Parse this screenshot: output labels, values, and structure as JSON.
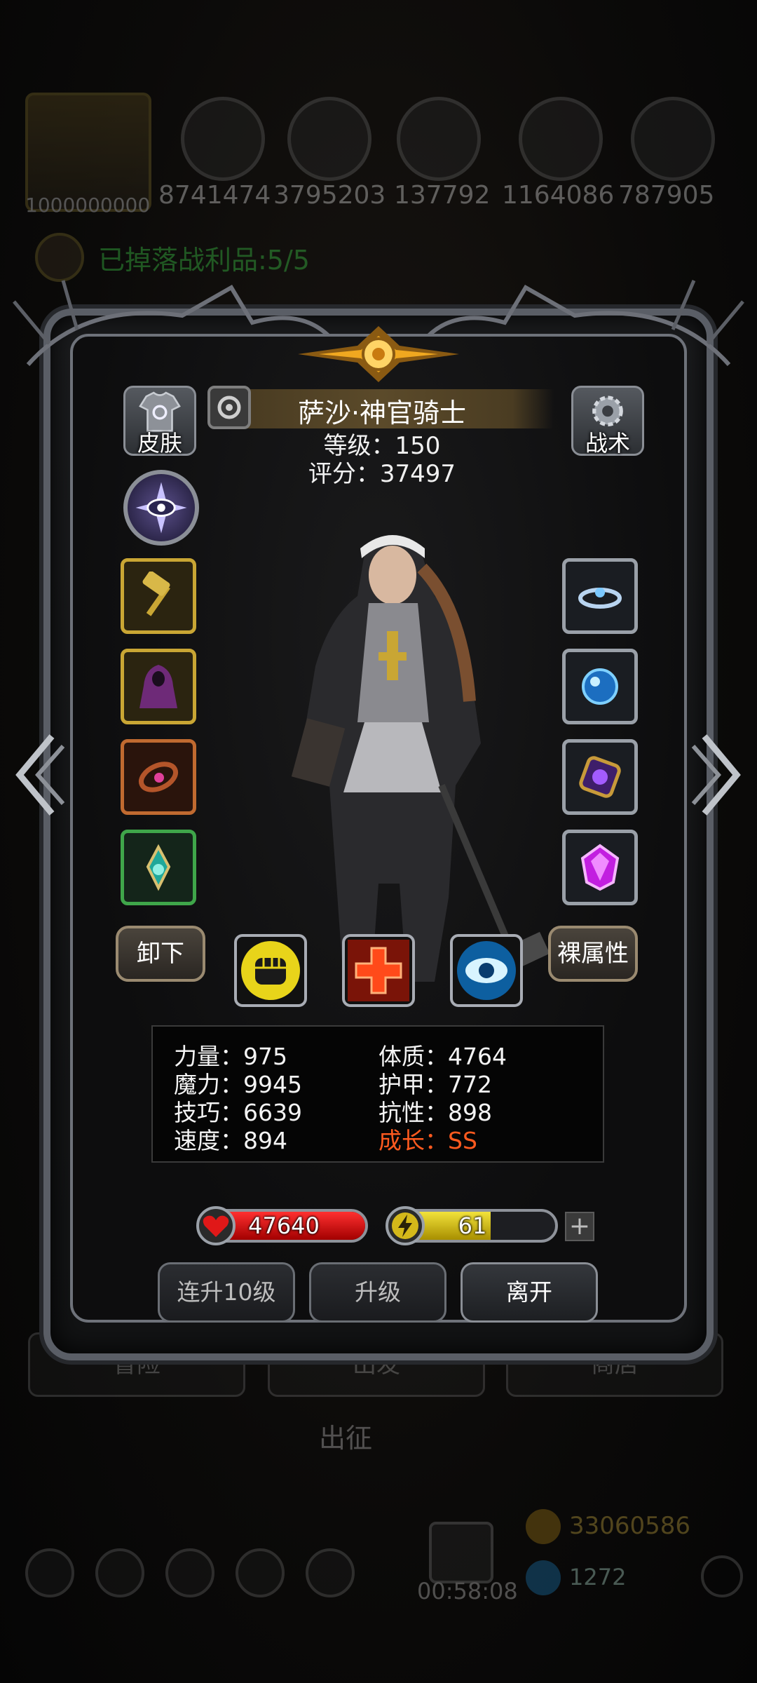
{
  "background": {
    "portrait_number": "1000000000",
    "resources": [
      "8741474",
      "3795203",
      "137792",
      "1164086",
      "787905"
    ],
    "loot_text": "已掉落战利品:5/5",
    "bottom_buttons": [
      "冒险",
      "出发",
      "商店"
    ],
    "center_label": "出征",
    "timer": "00:58:08",
    "gold": "33060586",
    "gems": "1272"
  },
  "panel": {
    "skin_label": "皮肤",
    "tactic_label": "战术",
    "hero_name": "萨沙·神官骑士",
    "level": "等级：150",
    "score": "评分：37497"
  },
  "equipment": {
    "left": [
      "hammer-icon",
      "hooded-robe-icon",
      "chain-bracelet-icon",
      "teal-amulet-icon"
    ],
    "right": [
      "tiara-icon",
      "blue-orb-icon",
      "purple-ring-icon",
      "purple-crystal-icon"
    ]
  },
  "actions": {
    "unequip": "卸下",
    "base_attr": "裸属性",
    "skills": [
      "fist-icon",
      "red-cross-icon",
      "blue-eye-icon"
    ]
  },
  "stats": {
    "str": "力量：975",
    "con": "体质：4764",
    "mag": "魔力：9945",
    "armor": "护甲：772",
    "skill": "技巧：6639",
    "resist": "抗性：898",
    "speed": "速度：894",
    "growth": "成长：SS"
  },
  "bars": {
    "hp_value": "47640",
    "hp_fill": 1.0,
    "energy_value": "61",
    "energy_fill": 0.61,
    "plus": "+"
  },
  "buttons": {
    "level_up_10": "连升10级",
    "level_up": "升级",
    "leave": "离开"
  },
  "colors": {
    "growth": "#ff5a1f",
    "hp": "#e01818",
    "energy": "#e8d72a",
    "loot": "#3fd34a"
  }
}
